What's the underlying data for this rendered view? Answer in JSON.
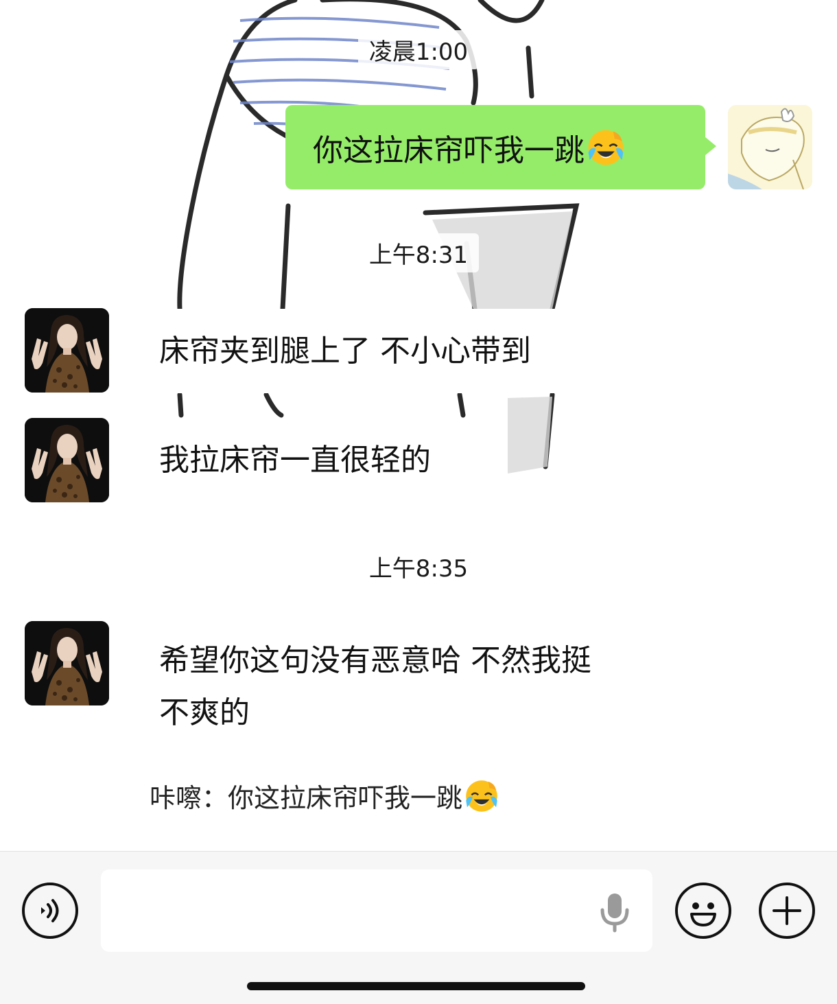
{
  "chat": {
    "timestamps": [
      "凌晨1:00",
      "上午8:31",
      "上午8:35"
    ],
    "messages": {
      "sent": "你这拉床帘吓我一跳",
      "received_1": "床帘夹到腿上了 不小心带到",
      "received_2": "我拉床帘一直很轻的",
      "received_3_line1": "希望你这句没有恶意哈 不然我挺",
      "received_3_line2": "不爽的"
    },
    "quote": {
      "sender": "咔嚓：",
      "text": "你这拉床帘吓我一跳"
    },
    "emoji": "face-with-tears-of-joy-emoji"
  },
  "toolbar": {
    "voice_icon": "voice-mode-icon",
    "mic_icon": "microphone-icon",
    "emoji_icon": "smiley-icon",
    "plus_icon": "plus-icon",
    "input_value": ""
  },
  "colors": {
    "sent_bubble": "#95ec69",
    "received_bubble": "#ffffff",
    "toolbar_bg": "#f6f6f6"
  }
}
